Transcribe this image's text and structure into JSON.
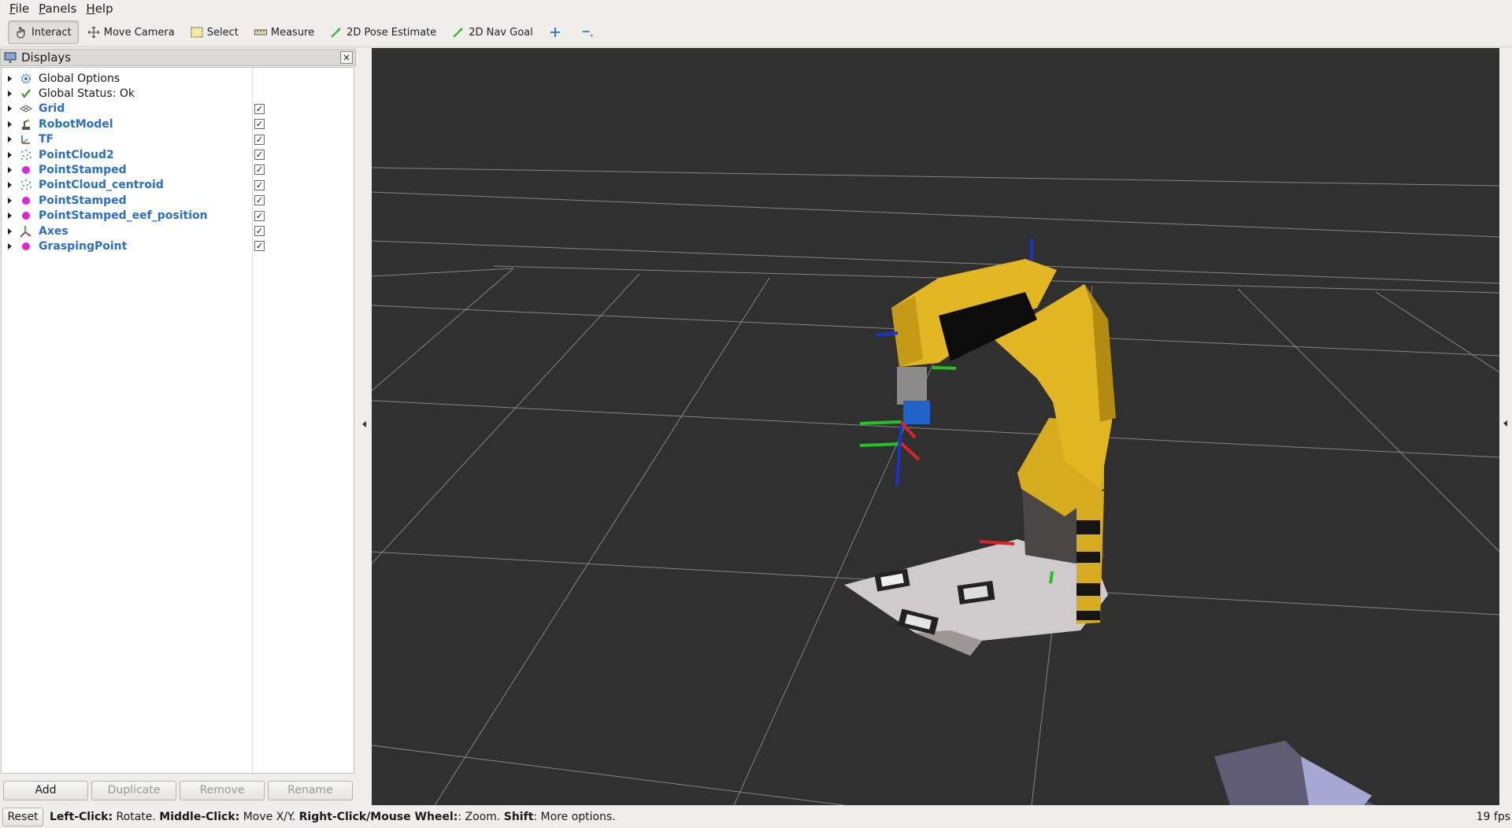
{
  "menu": [
    {
      "mnemonic": "F",
      "rest": "ile"
    },
    {
      "mnemonic": "P",
      "rest": "anels"
    },
    {
      "mnemonic": "H",
      "rest": "elp"
    }
  ],
  "toolbar": {
    "interact": "Interact",
    "move_camera": "Move Camera",
    "select": "Select",
    "measure": "Measure",
    "pose_estimate": "2D Pose Estimate",
    "nav_goal": "2D Nav Goal"
  },
  "displays": {
    "title": "Displays",
    "close_glyph": "×",
    "items": [
      {
        "label": "Global Options",
        "icon": "gear-icon",
        "checkable": false,
        "checked": false
      },
      {
        "label": "Global Status: Ok",
        "icon": "checkmark-icon",
        "checkable": false,
        "checked": false
      },
      {
        "label": "Grid",
        "icon": "grid-icon",
        "checkable": true,
        "checked": true
      },
      {
        "label": "RobotModel",
        "icon": "robot-icon",
        "checkable": true,
        "checked": true
      },
      {
        "label": "TF",
        "icon": "tf-icon",
        "checkable": true,
        "checked": true
      },
      {
        "label": "PointCloud2",
        "icon": "pointcloud-icon",
        "checkable": true,
        "checked": true
      },
      {
        "label": "PointStamped",
        "icon": "point-icon",
        "checkable": true,
        "checked": true
      },
      {
        "label": "PointCloud_centroid",
        "icon": "pointcloud-icon",
        "checkable": true,
        "checked": true
      },
      {
        "label": "PointStamped",
        "icon": "point-icon",
        "checkable": true,
        "checked": true
      },
      {
        "label": "PointStamped_eef_position",
        "icon": "point-icon",
        "checkable": true,
        "checked": true
      },
      {
        "label": "Axes",
        "icon": "axes-icon",
        "checkable": true,
        "checked": true
      },
      {
        "label": "GraspingPoint",
        "icon": "point-icon",
        "checkable": true,
        "checked": true
      }
    ],
    "checkmark": "✓"
  },
  "panel_buttons": {
    "add": "Add",
    "duplicate": "Duplicate",
    "remove": "Remove",
    "rename": "Rename"
  },
  "status": {
    "reset": "Reset",
    "help_segments": [
      {
        "text": "Left-Click:",
        "bold": true
      },
      {
        "text": " Rotate. ",
        "bold": false
      },
      {
        "text": "Middle-Click:",
        "bold": true
      },
      {
        "text": " Move X/Y. ",
        "bold": false
      },
      {
        "text": "Right-Click/Mouse Wheel:",
        "bold": true
      },
      {
        "text": ": Zoom. ",
        "bold": false
      },
      {
        "text": "Shift",
        "bold": true
      },
      {
        "text": ": More options.",
        "bold": false
      }
    ],
    "fps": "19 fps"
  },
  "colors": {
    "viewport_bg": "#303030",
    "grid_line": "#a0a0a0",
    "robot_yellow": "#d7ab1f",
    "display_label_blue": "#2a6fc2",
    "point_magenta": "#e025d6"
  }
}
